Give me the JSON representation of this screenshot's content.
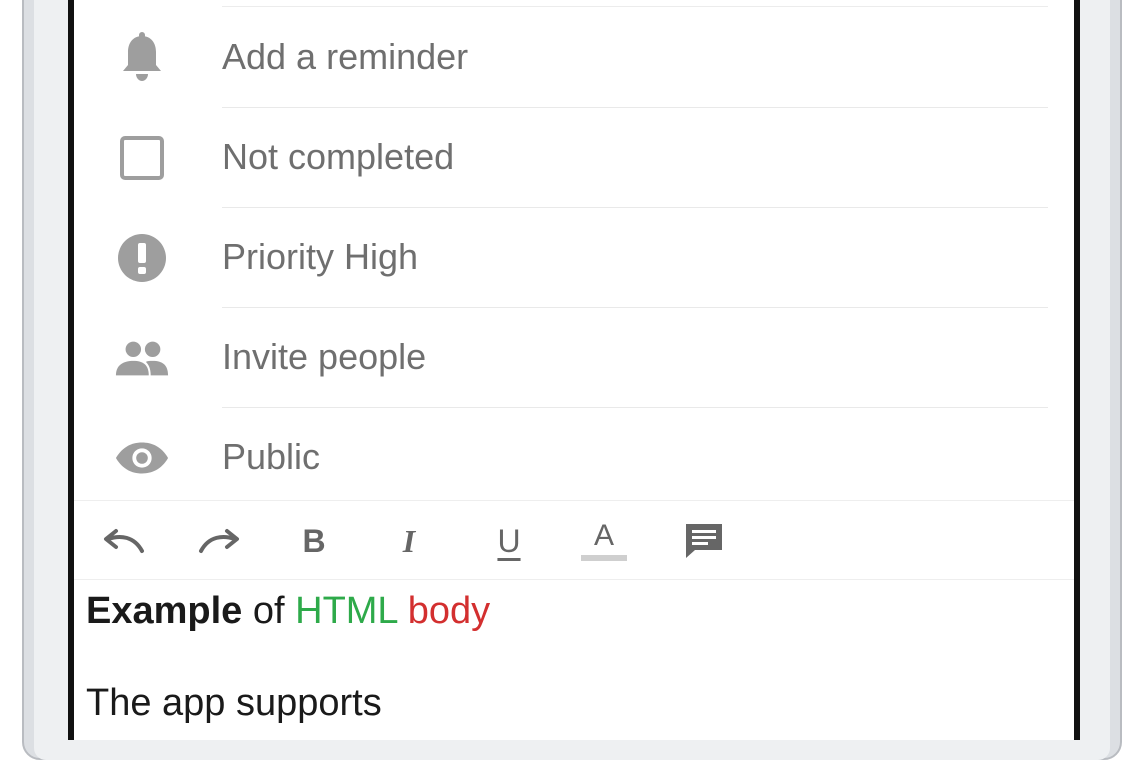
{
  "options": [
    {
      "icon": "bell-icon",
      "label": "Add a reminder"
    },
    {
      "icon": "checkbox-icon",
      "label": "Not completed"
    },
    {
      "icon": "priority-exclamation-icon",
      "label": "Priority High"
    },
    {
      "icon": "people-icon",
      "label": "Invite people"
    },
    {
      "icon": "eye-icon",
      "label": "Public"
    }
  ],
  "toolbar": {
    "buttons": [
      "undo-icon",
      "redo-icon",
      "bold-icon",
      "italic-icon",
      "underline-icon",
      "text-color-icon",
      "comment-icon"
    ],
    "bold_glyph": "B",
    "italic_glyph": "I",
    "underline_glyph": "U",
    "text_color_glyph": "A"
  },
  "editor": {
    "word_example": "Example",
    "word_of": " of ",
    "word_html": "HTML",
    "word_body": " body",
    "line2": "The app supports",
    "colors": {
      "html": "#2eaa4a",
      "body": "#d32f2f",
      "icon": "#9e9e9e"
    }
  }
}
